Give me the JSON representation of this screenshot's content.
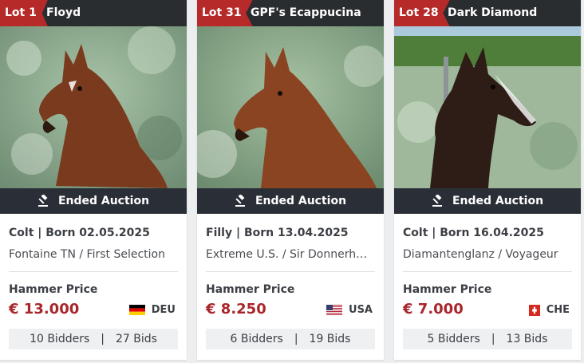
{
  "lots": [
    {
      "lot_label": "Lot 1",
      "name": "Floyd",
      "status": "Ended Auction",
      "meta": "Colt | Born 02.05.2025",
      "pedigree": "Fontaine TN / First Selection",
      "hammer_label": "Hammer Price",
      "price": "€ 13.000",
      "country": "DEU",
      "flag": "germany-flag",
      "bidders": "10 Bidders",
      "separator": "|",
      "bids": "27 Bids"
    },
    {
      "lot_label": "Lot 31",
      "name": "GPF's Ecappucina",
      "status": "Ended Auction",
      "meta": "Filly | Born 13.04.2025",
      "pedigree": "Extreme U.S. / Sir Donnerh…",
      "hammer_label": "Hammer Price",
      "price": "€ 8.250",
      "country": "USA",
      "flag": "usa-flag",
      "bidders": "6 Bidders",
      "separator": "|",
      "bids": "19 Bids"
    },
    {
      "lot_label": "Lot 28",
      "name": "Dark Diamond",
      "status": "Ended Auction",
      "meta": "Colt | Born 16.04.2025",
      "pedigree": "Diamantenglanz / Voyageur",
      "hammer_label": "Hammer Price",
      "price": "€ 7.000",
      "country": "CHE",
      "flag": "switzerland-flag",
      "bidders": "5 Bidders",
      "separator": "|",
      "bids": "13 Bids"
    }
  ],
  "colors": {
    "lot_tag": "#b72a2a",
    "header": "#2a2d30",
    "status_bar": "#2a2f37",
    "price": "#a8262b"
  }
}
